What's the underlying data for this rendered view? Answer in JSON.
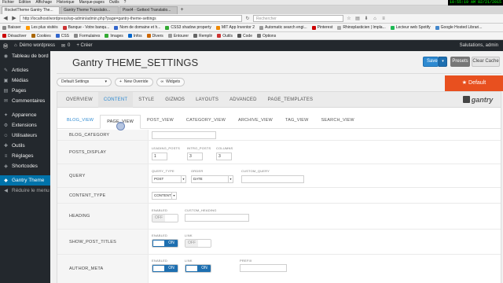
{
  "browser": {
    "menu": [
      "Fichier",
      "Edition",
      "Affichage",
      "Historique",
      "Marque-pages",
      "Outils",
      "?"
    ],
    "clock": "10:55:19 AM 02/21/2015",
    "tabs": [
      {
        "label": "RocketTheme Gantry The..."
      },
      {
        "label": "Gantry Theme Translatio..."
      },
      {
        "label": "Pixel4 - Gettext Translatio..."
      }
    ],
    "url": "http://localhost/wordpress/wp-admin/admin.php?page=gantry-theme-settings",
    "search_placeholder": "Rechercher",
    "bookmarks1": [
      "Baisser",
      "Les plus visités",
      "Banque - Votre banqu...",
      "Nom de domaine et h...",
      "CSS3 shadow property",
      "MIT App Inventor 2",
      "Automatic search engi...",
      "Pinterest",
      "Rhinoplasticien | Impla...",
      "Lecteur web Spotify",
      "Google Hosted Librari..."
    ],
    "bookmarks2": [
      "Désactiver",
      "Cookies",
      "CSS",
      "Formulaires",
      "Images",
      "Infos",
      "Divers",
      "Entourer",
      "Remplir",
      "Outils",
      "Code",
      "Options"
    ]
  },
  "adminbar": {
    "site_name": "Démo wordpress",
    "comments_count": "0",
    "new_label": "+ Créer",
    "greeting": "Salutations, admin"
  },
  "sidebar": {
    "items": [
      {
        "label": "Tableau de bord",
        "icon": "dashboard-icon",
        "glyph": "◉"
      },
      {
        "label": "Articles",
        "icon": "pin-icon",
        "glyph": "✎"
      },
      {
        "label": "Médias",
        "icon": "media-icon",
        "glyph": "▣"
      },
      {
        "label": "Pages",
        "icon": "pages-icon",
        "glyph": "▤"
      },
      {
        "label": "Commentaires",
        "icon": "comment-icon",
        "glyph": "✉"
      },
      {
        "label": "Apparence",
        "icon": "brush-icon",
        "glyph": "✦"
      },
      {
        "label": "Extensions",
        "icon": "plugin-icon",
        "glyph": "⚙"
      },
      {
        "label": "Utilisateurs",
        "icon": "users-icon",
        "glyph": "☺"
      },
      {
        "label": "Outils",
        "icon": "wrench-icon",
        "glyph": "✚"
      },
      {
        "label": "Réglages",
        "icon": "settings-icon",
        "glyph": "≡"
      },
      {
        "label": "Shortcodes",
        "icon": "shortcode-icon",
        "glyph": "◈"
      },
      {
        "label": "Gantry Theme",
        "icon": "gantry-icon",
        "glyph": "◆"
      },
      {
        "label": "Réduire le menu",
        "icon": "collapse-icon",
        "glyph": "◀"
      }
    ]
  },
  "header": {
    "title": "Gantry THEME_SETTINGS",
    "save_label": "Save",
    "presets_label": "Presets",
    "clear_cache_label": "Clear Cache"
  },
  "toolbar": {
    "settings_select": "Default Settings",
    "new_override": "New Override",
    "widgets": "Widgets",
    "default_badge": "★ Default"
  },
  "main_tabs": [
    "OVERVIEW",
    "CONTENT",
    "STYLE",
    "GIZMOS",
    "LAYOUTS",
    "ADVANCED",
    "PAGE_TEMPLATES"
  ],
  "active_main_tab": "CONTENT",
  "logo_text": "gantry",
  "sub_tabs": [
    "BLOG_VIEW",
    "PAGE_VIEW",
    "POST_VIEW",
    "CATEGORY_VIEW",
    "ARCHIVE_VIEW",
    "TAG_VIEW",
    "SEARCH_VIEW"
  ],
  "rows": {
    "blog_category": {
      "label": "BLOG_CATEGORY",
      "value": ""
    },
    "posts_display": {
      "label": "POSTS_DISPLAY",
      "leading_caption": "LEADING_POSTS",
      "leading_value": "1",
      "intro_caption": "INTRO_POSTS",
      "intro_value": "3",
      "columns_caption": "COLUMNS",
      "columns_value": "3"
    },
    "query": {
      "label": "QUERY",
      "type_caption": "QUERY_TYPE",
      "type_value": "POST",
      "order_caption": "ORDER",
      "order_value": "DATE",
      "custom_caption": "CUSTOM_QUERY",
      "custom_value": ""
    },
    "content_type": {
      "label": "CONTENT_TYPE",
      "value": "CONTENT"
    },
    "heading": {
      "label": "HEADING",
      "enabled_caption": "ENABLED",
      "enabled_value": "OFF",
      "custom_caption": "CUSTOM_HEADING",
      "custom_value": ""
    },
    "show_post_titles": {
      "label": "SHOW_POST_TITLES",
      "enabled_caption": "ENABLED",
      "enabled_value": "ON",
      "link_caption": "LINK",
      "link_value": "OFF"
    },
    "author_meta": {
      "label": "AUTHOR_META",
      "enabled_caption": "ENABLED",
      "enabled_value": "ON",
      "link_caption": "LINK",
      "link_value": "ON",
      "prefix_caption": "PREFIX",
      "prefix_value": ""
    }
  }
}
